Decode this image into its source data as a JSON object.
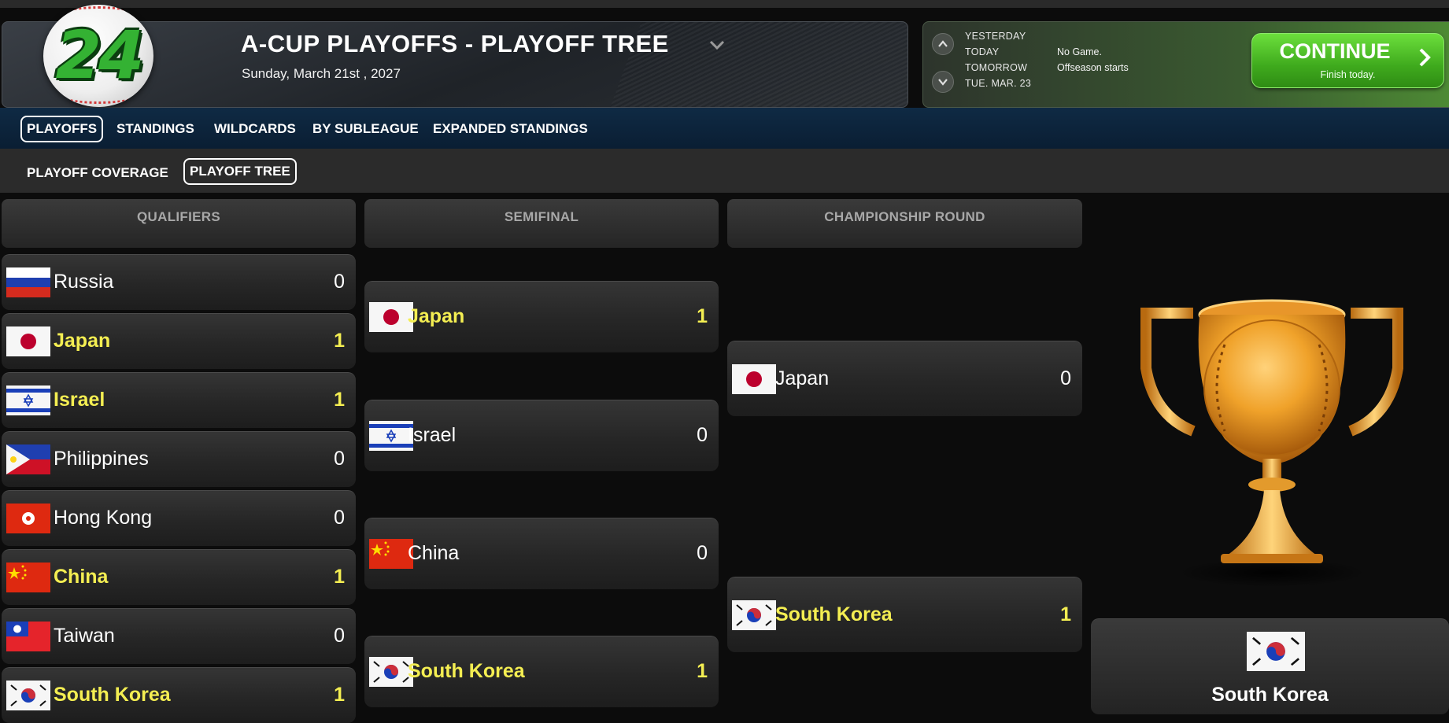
{
  "header": {
    "logo_text": "24",
    "title": "A-CUP PLAYOFFS - PLAYOFF TREE",
    "date": "Sunday, March 21st , 2027"
  },
  "calendar": {
    "rows": [
      {
        "label": "YESTERDAY",
        "note": ""
      },
      {
        "label": "TODAY",
        "note": "No Game."
      },
      {
        "label": "TOMORROW",
        "note": "Offseason starts"
      },
      {
        "label": "TUE. MAR. 23",
        "note": ""
      }
    ]
  },
  "continue": {
    "label": "CONTINUE",
    "sub": "Finish today."
  },
  "nav": {
    "main_tabs": [
      "PLAYOFFS",
      "STANDINGS",
      "WILDCARDS",
      "BY SUBLEAGUE",
      "EXPANDED STANDINGS"
    ],
    "main_active": "PLAYOFFS",
    "sub_tabs": [
      "PLAYOFF COVERAGE",
      "PLAYOFF TREE"
    ],
    "sub_active": "PLAYOFF TREE"
  },
  "bracket": {
    "columns": [
      "QUALIFIERS",
      "SEMIFINAL",
      "CHAMPIONSHIP ROUND"
    ],
    "qualifiers": [
      {
        "team": "Russia",
        "score": "0",
        "winner": false,
        "flag": "russia"
      },
      {
        "team": "Japan",
        "score": "1",
        "winner": true,
        "flag": "japan"
      },
      {
        "team": "Israel",
        "score": "1",
        "winner": true,
        "flag": "israel"
      },
      {
        "team": "Philippines",
        "score": "0",
        "winner": false,
        "flag": "philippines"
      },
      {
        "team": "Hong Kong",
        "score": "0",
        "winner": false,
        "flag": "hongkong"
      },
      {
        "team": "China",
        "score": "1",
        "winner": true,
        "flag": "china"
      },
      {
        "team": "Taiwan",
        "score": "0",
        "winner": false,
        "flag": "taiwan"
      },
      {
        "team": "South Korea",
        "score": "1",
        "winner": true,
        "flag": "southkorea"
      }
    ],
    "semifinal": [
      {
        "team": "Japan",
        "score": "1",
        "winner": true,
        "flag": "japan"
      },
      {
        "team": "Israel",
        "score": "0",
        "winner": false,
        "flag": "israel"
      },
      {
        "team": "China",
        "score": "0",
        "winner": false,
        "flag": "china"
      },
      {
        "team": "South Korea",
        "score": "1",
        "winner": true,
        "flag": "southkorea"
      }
    ],
    "championship": [
      {
        "team": "Japan",
        "score": "0",
        "winner": false,
        "flag": "japan"
      },
      {
        "team": "South Korea",
        "score": "1",
        "winner": true,
        "flag": "southkorea"
      }
    ],
    "champion": {
      "team": "South Korea",
      "flag": "southkorea",
      "icon": "trophy-icon"
    }
  },
  "colors": {
    "winner": "#f4ee52",
    "accent_green": "#3faa1d",
    "nav_blue": "#0f2a44"
  }
}
